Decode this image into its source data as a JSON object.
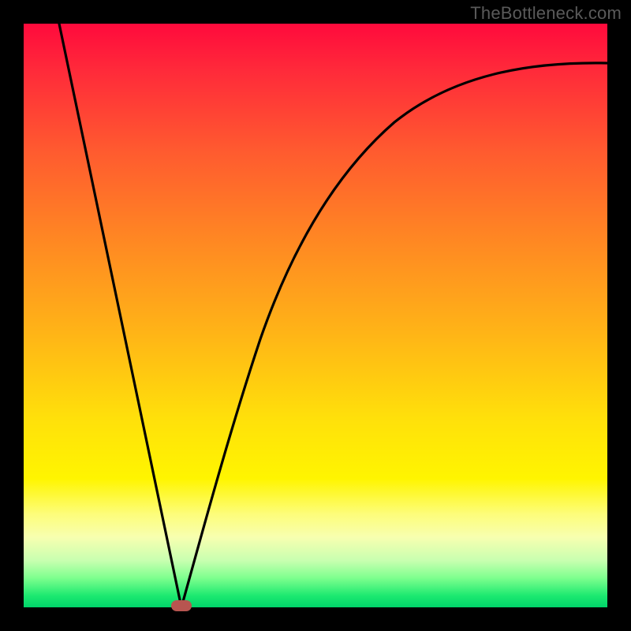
{
  "watermark": "TheBottleneck.com",
  "colors": {
    "frame": "#000000",
    "gradient_top": "#ff0a3c",
    "gradient_bottom": "#00d46a",
    "curve": "#000000",
    "marker": "#b75550"
  },
  "chart_data": {
    "type": "line",
    "title": "",
    "xlabel": "",
    "ylabel": "",
    "xlim": [
      0,
      100
    ],
    "ylim": [
      0,
      100
    ],
    "grid": false,
    "legend": false,
    "annotations": [
      "TheBottleneck.com"
    ],
    "series": [
      {
        "name": "left-branch",
        "x": [
          6,
          9,
          12,
          15,
          18,
          21,
          23,
          25,
          27
        ],
        "y": [
          100,
          86,
          72,
          58,
          44,
          30,
          18,
          7,
          0
        ]
      },
      {
        "name": "right-branch",
        "x": [
          27,
          29,
          31,
          34,
          38,
          42,
          47,
          53,
          60,
          68,
          77,
          87,
          100
        ],
        "y": [
          0,
          8,
          17,
          28,
          40,
          50,
          59,
          67,
          74,
          80,
          85,
          89,
          93
        ]
      }
    ],
    "marker": {
      "x": 27,
      "y": 0,
      "shape": "pill"
    },
    "notes": "V-shaped bottleneck curve on rainbow gradient; minimum at x≈27, y=0. Values estimated from pixels; no numeric axes shown."
  }
}
